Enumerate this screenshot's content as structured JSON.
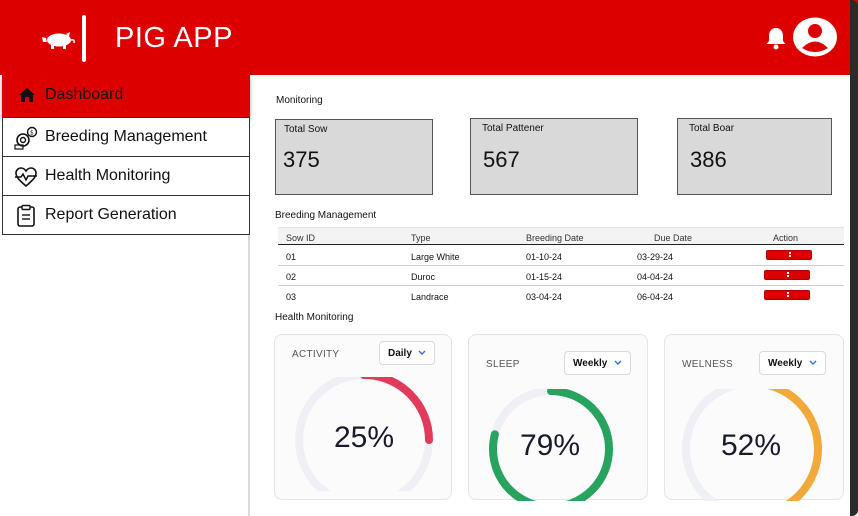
{
  "app": {
    "title": "PIG APP"
  },
  "header": {
    "icons": [
      "pig-logo-icon",
      "bell-icon",
      "user-avatar-icon"
    ]
  },
  "colors": {
    "brand_red": "#dd0000",
    "activity": "#e23a5a",
    "sleep": "#27a35f",
    "wellness": "#f1a93b",
    "track": "#eef0f5"
  },
  "sidebar": {
    "items": [
      {
        "label": "Dashboard",
        "icon": "home-icon",
        "active": true
      },
      {
        "label": "Breeding Management",
        "icon": "breeding-icon",
        "active": false
      },
      {
        "label": "Health Monitoring",
        "icon": "heart-pulse-icon",
        "active": false
      },
      {
        "label": "Report Generation",
        "icon": "clipboard-icon",
        "active": false
      }
    ]
  },
  "monitoring": {
    "title": "Monitoring",
    "cards": [
      {
        "label": "Total Sow",
        "value": "375"
      },
      {
        "label": "Total Pattener",
        "value": "567"
      },
      {
        "label": "Total Boar",
        "value": "386"
      }
    ]
  },
  "breeding": {
    "title": "Breeding Management",
    "columns": [
      "Sow ID",
      "Type",
      "Breeding Date",
      "Due Date",
      "Action"
    ],
    "rows": [
      [
        "01",
        "Large White",
        "01-10-24",
        "03-29-24"
      ],
      [
        "02",
        "Duroc",
        "01-15-24",
        "04-04-24"
      ],
      [
        "03",
        "Landrace",
        "03-04-24",
        "06-04-24"
      ]
    ],
    "action_icon": "more-vertical-icon"
  },
  "health": {
    "title": "Health Monitoring",
    "metrics": [
      {
        "label": "ACTIVITY",
        "period": "Daily",
        "value_text": "25%",
        "value": 25
      },
      {
        "label": "SLEEP",
        "period": "Weekly",
        "value_text": "79%",
        "value": 79
      },
      {
        "label": "WELNESS",
        "period": "Weekly",
        "value_text": "52%",
        "value": 52
      }
    ]
  }
}
